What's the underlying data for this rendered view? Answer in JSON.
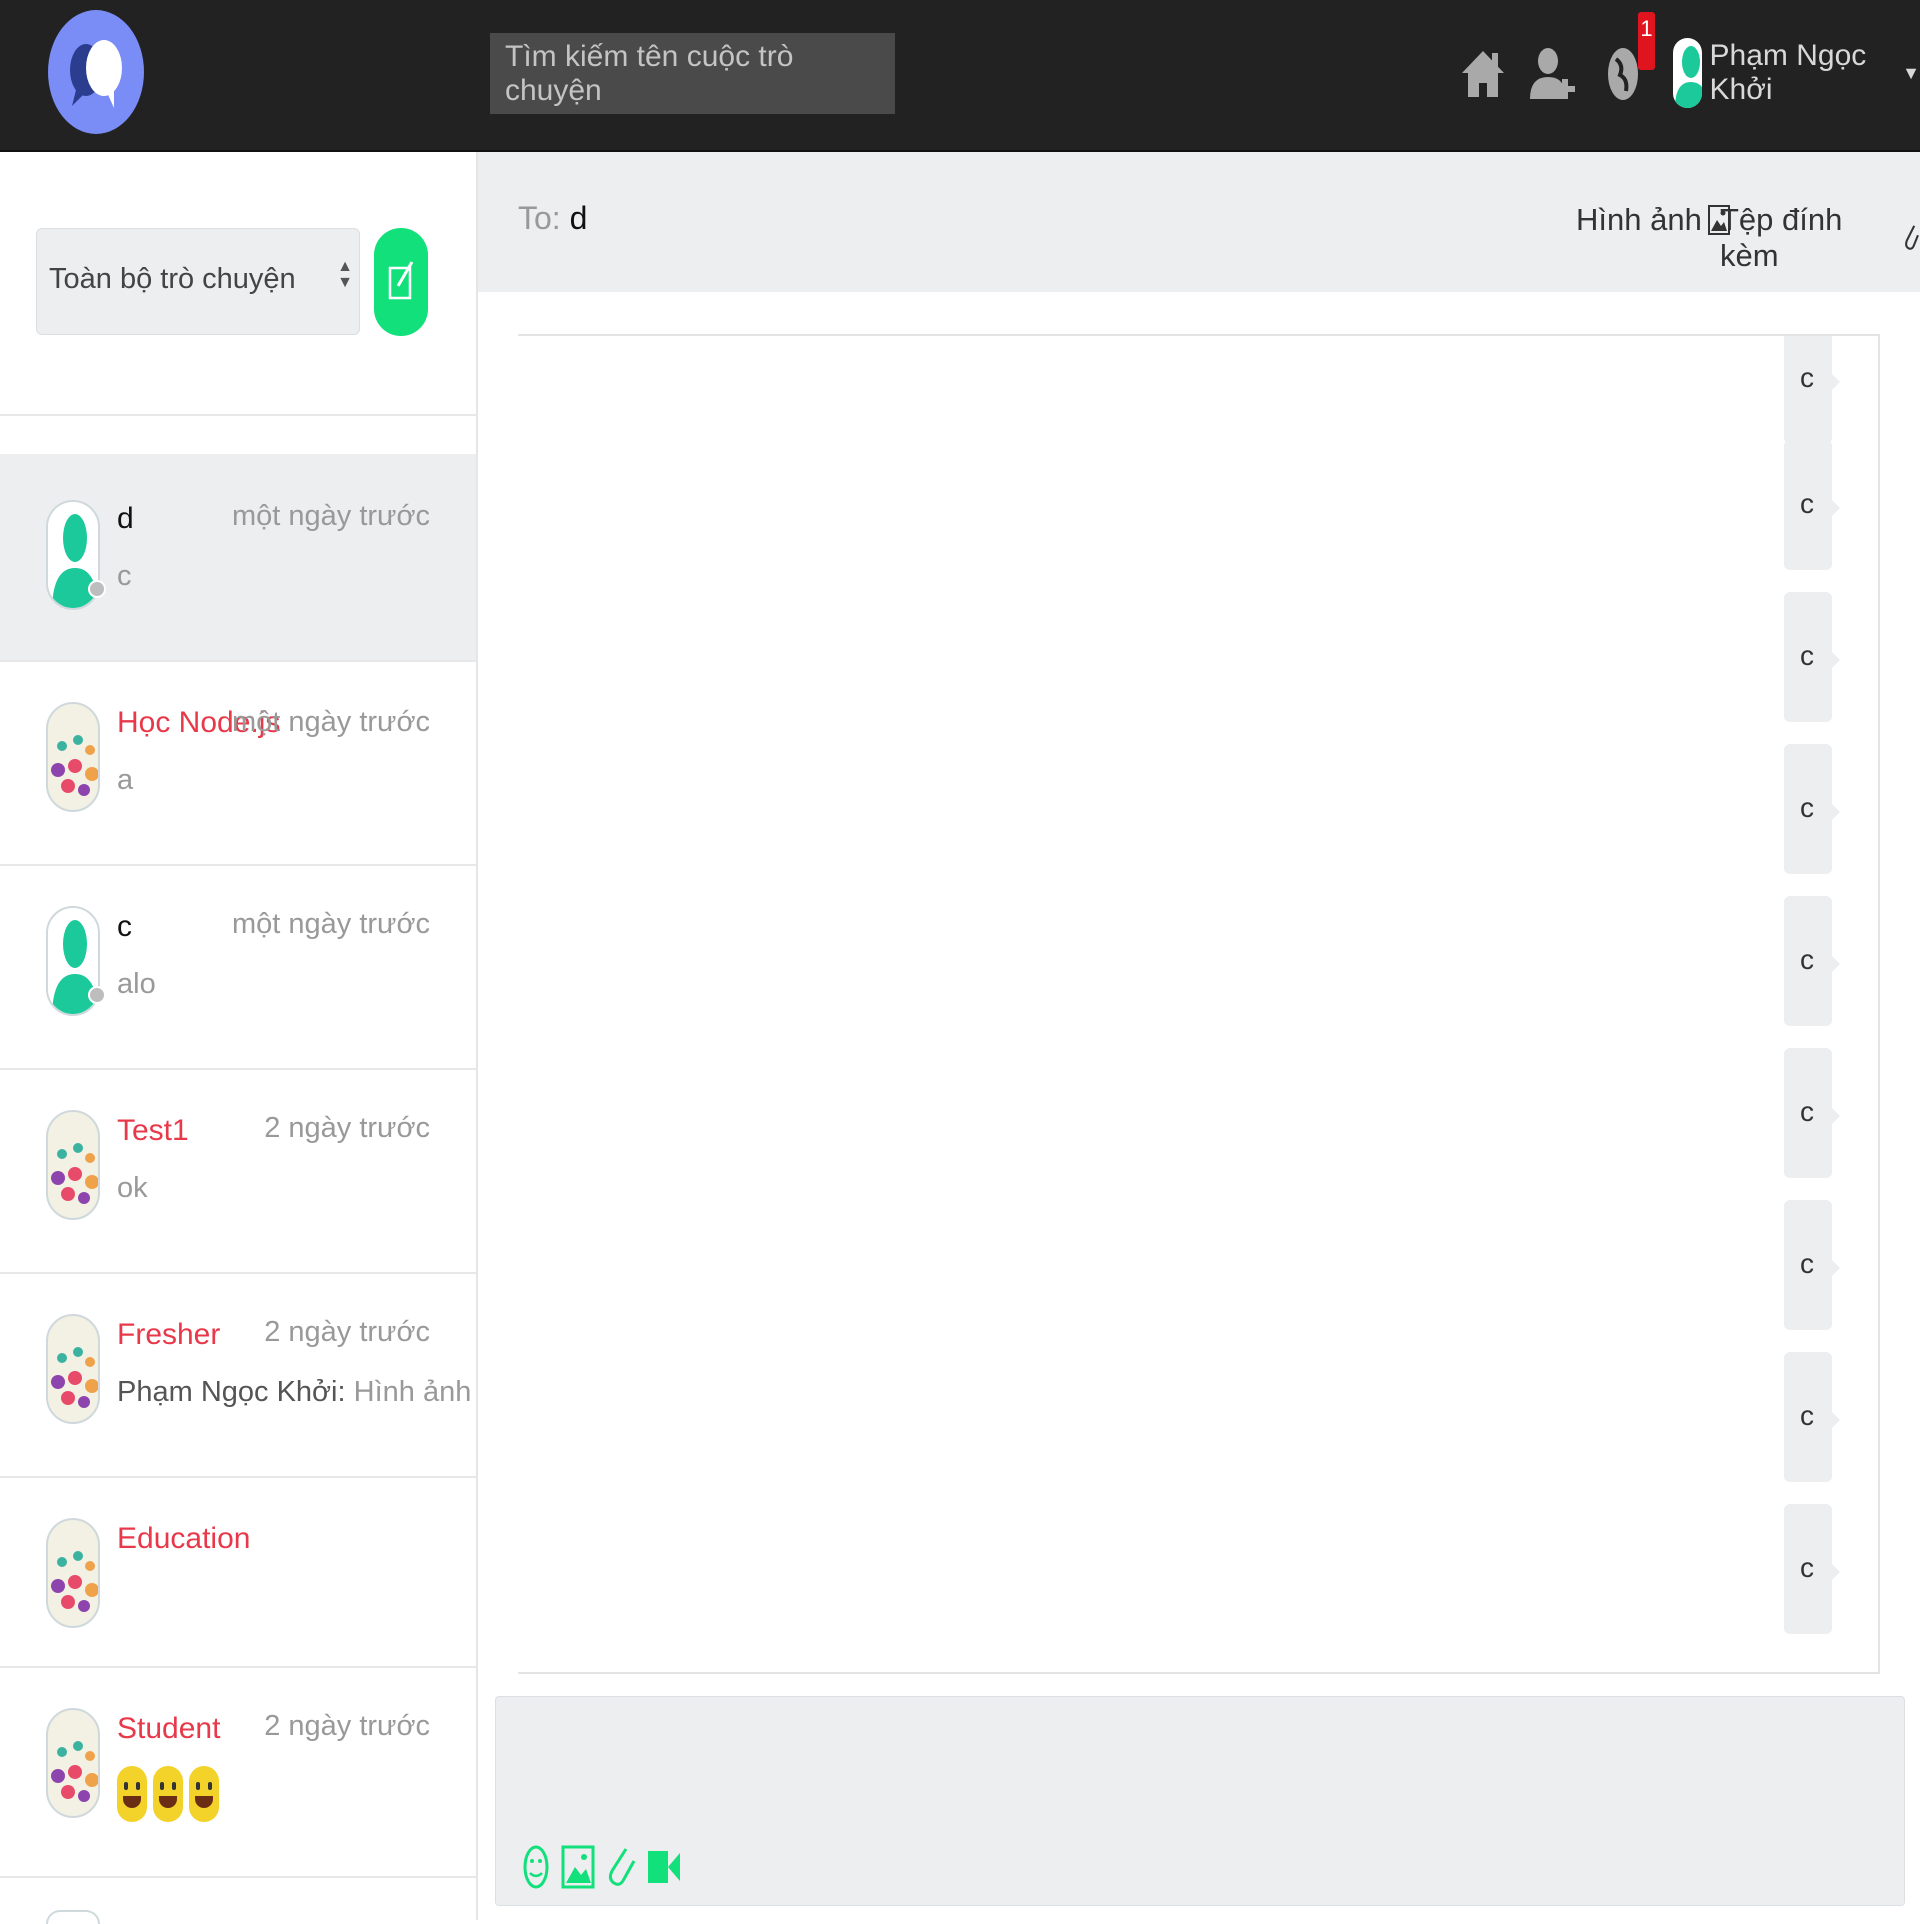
{
  "colors": {
    "accent": "#11e07b",
    "topbar": "#222222",
    "group_name": "#e8394b",
    "badge": "#e0141e",
    "logo": "#7a8cf5"
  },
  "header": {
    "search_placeholder": "Tìm kiếm tên cuộc trò chuyện",
    "icons": [
      "home-icon",
      "add-user-icon",
      "globe-icon"
    ],
    "notification_count": "1",
    "user_name": "Phạm Ngọc Khởi",
    "caret": "▼"
  },
  "sidebar": {
    "filter_value": "Toàn bộ trò chuyện",
    "compose_icon": "compose-icon",
    "conversations": [
      {
        "name": "d",
        "type": "person",
        "time": "một ngày trước",
        "last": "c",
        "active": true
      },
      {
        "name": "Học Node.js",
        "type": "group",
        "time": "một ngày trước",
        "last": "a"
      },
      {
        "name": "c",
        "type": "person",
        "time": "một ngày trước",
        "last": "alo"
      },
      {
        "name": "Test1",
        "type": "group",
        "time": "2 ngày trước",
        "last": "ok"
      },
      {
        "name": "Fresher",
        "type": "group",
        "time": "2 ngày trước",
        "last_sender": "Phạm Ngọc Khởi:",
        "last": "Hình ảnh"
      },
      {
        "name": "Education",
        "type": "group",
        "time": "",
        "last": ""
      },
      {
        "name": "Student",
        "type": "group",
        "time": "2 ngày trước",
        "last": "",
        "last_emoji_count": 3
      }
    ]
  },
  "chat": {
    "to_label": "To:",
    "to_name": "d",
    "images_label": "Hình ảnh",
    "attachments_label": "Tệp đính kèm",
    "messages": [
      "c",
      "c",
      "c",
      "c",
      "c",
      "c",
      "c",
      "c",
      "c"
    ],
    "composer_tools": [
      "emoji-icon",
      "image-icon",
      "paperclip-icon",
      "video-icon"
    ]
  }
}
